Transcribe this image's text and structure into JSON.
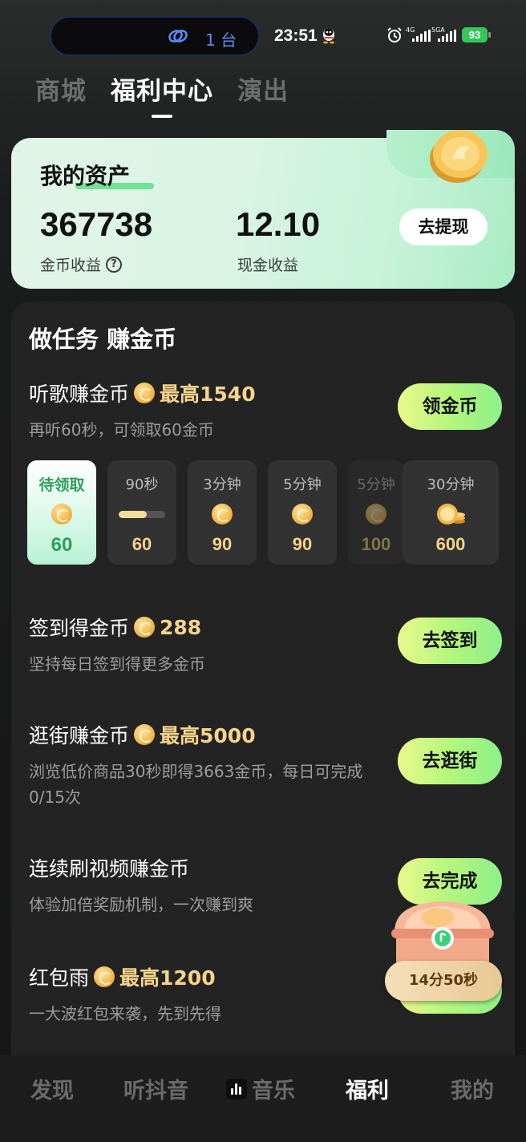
{
  "status_bar": {
    "device_count": "1 台",
    "time": "23:51",
    "signal1_label": "4G",
    "signal2_label": "5GA",
    "battery": "93"
  },
  "top_tabs": [
    {
      "label": "商城",
      "active": false
    },
    {
      "label": "福利中心",
      "active": true
    },
    {
      "label": "演出",
      "active": false
    }
  ],
  "assets": {
    "title": "我的资产",
    "coin_value": "367738",
    "coin_label": "金币收益",
    "cash_value": "12.10",
    "cash_label": "现金收益",
    "withdraw_label": "去提现"
  },
  "tasks": {
    "heading": "做任务 赚金币",
    "listen": {
      "name": "听歌赚金币",
      "max": "最高1540",
      "desc": "再听60秒，可领取60金币",
      "button": "领金币",
      "slots": [
        {
          "label": "待领取",
          "amount": "60"
        },
        {
          "label": "90秒",
          "amount": "60",
          "progress": 0.6
        },
        {
          "label": "3分钟",
          "amount": "90"
        },
        {
          "label": "5分钟",
          "amount": "90"
        },
        {
          "label": "5分钟",
          "amount": "100"
        },
        {
          "label": "30分钟",
          "amount": "600"
        }
      ]
    },
    "signin": {
      "name": "签到得金币",
      "max": "288",
      "desc": "坚持每日签到得更多金币",
      "button": "去签到"
    },
    "shopping": {
      "name": "逛街赚金币",
      "max": "最高5000",
      "desc": "浏览低价商品30秒即得3663金币，每日可完成0/15次",
      "button": "去逛街"
    },
    "video": {
      "name": "连续刷视频赚金币",
      "desc": "体验加倍奖励机制，一次赚到爽",
      "button": "去完成"
    },
    "redpacket": {
      "name": "红包雨",
      "max": "最高1200",
      "desc": "一大波红包来袭，先到先得"
    }
  },
  "chest": {
    "timer": "14分50秒"
  },
  "bottom_nav": [
    {
      "label": "发现",
      "active": false
    },
    {
      "label": "听抖音",
      "active": false
    },
    {
      "label": "音乐",
      "active": false
    },
    {
      "label": "福利",
      "active": true
    },
    {
      "label": "我的",
      "active": false
    }
  ],
  "colors": {
    "accent_green": "#9ff080",
    "gold": "#f6d48a",
    "battery": "#34c759"
  }
}
